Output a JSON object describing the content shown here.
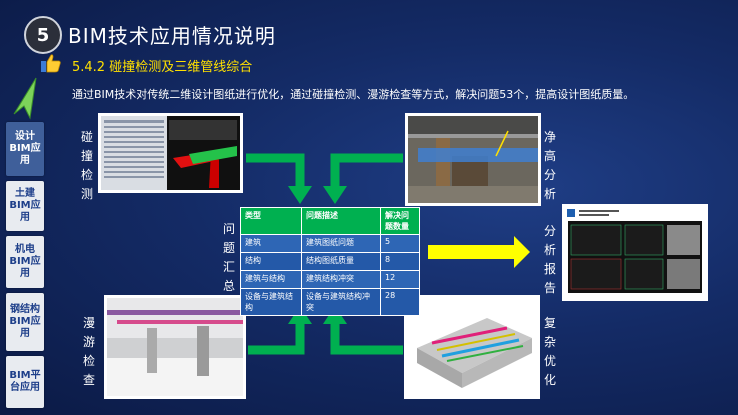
{
  "header": {
    "number": "5",
    "title": "BIM技术应用情况说明"
  },
  "section": {
    "title": "5.4.2 碰撞检测及三维管线综合"
  },
  "description": "通过BIM技术对传统二维设计图纸进行优化，通过碰撞检测、漫游检查等方式，解决问题53个，提高设计图纸质量。",
  "sidebar": {
    "items": [
      {
        "label": "设计BIM应用",
        "active": true
      },
      {
        "label": "土建BIM应用"
      },
      {
        "label": "机电BIM应用"
      },
      {
        "label": "钢结构BIM应用"
      },
      {
        "label": "BIM平台应用"
      }
    ]
  },
  "labels": {
    "collision": "碰撞检测",
    "clearance": "净高分析",
    "summary": "问题汇总",
    "report": "分析报告",
    "walkthrough": "漫游检查",
    "optimize": "复杂优化"
  },
  "table": {
    "headers": [
      "类型",
      "问题描述",
      "解决问题数量"
    ],
    "rows": [
      [
        "建筑",
        "建筑图纸问题",
        "5"
      ],
      [
        "结构",
        "结构图纸质量",
        "8"
      ],
      [
        "建筑与结构",
        "建筑结构冲突",
        "12"
      ],
      [
        "设备与建筑结构",
        "设备与建筑结构冲突",
        "28"
      ]
    ]
  },
  "colors": {
    "accent": "#ffe000",
    "arrow_green": "#00b050",
    "table_header": "#00b050",
    "table_row": "#2e66b5"
  }
}
